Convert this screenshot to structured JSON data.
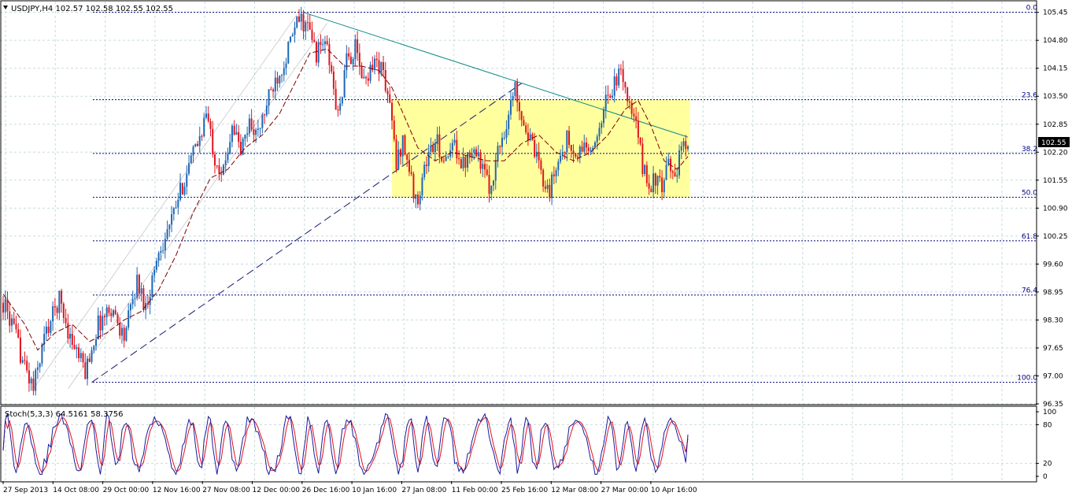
{
  "colors": {
    "background": "#ffffff",
    "grid": "#c8dcdc",
    "bull_candle": "#1e66b4",
    "bear_candle": "#e0141e",
    "moving_average": "#800000",
    "fib_lines": "#000080",
    "rectangle_fill": "#ffff9e",
    "resistance_line": "#0e8a8a",
    "support_line": "#1a1a6e",
    "stoch_main": "#1a1a9e",
    "stoch_signal": "#e01020",
    "price_label_bg": "#000000",
    "price_label_text": "#ffffff"
  },
  "header": {
    "title": "USDJPY,H4  102.57 102.58 102.55 102.55",
    "symbol": "USDJPY",
    "timeframe": "H4",
    "open": 102.57,
    "high": 102.58,
    "low": 102.55,
    "close": 102.55
  },
  "stochastic": {
    "label": "Stoch(5,3,3) 64.5161 58.3756",
    "main": 64.5161,
    "signal": 58.3756,
    "levels": [
      "100",
      "80",
      "20",
      "0"
    ]
  },
  "current_price": "102.55",
  "chart_data": {
    "type": "candlestick",
    "title": "USDJPY,H4",
    "ylim": [
      96.35,
      105.7
    ],
    "y_ticks": [
      "105.45",
      "104.80",
      "104.15",
      "103.50",
      "102.85",
      "102.20",
      "101.55",
      "100.90",
      "100.25",
      "99.60",
      "98.95",
      "98.30",
      "97.65",
      "97.00",
      "96.35"
    ],
    "x_ticks": [
      "27 Sep 2013",
      "14 Oct 08:00",
      "29 Oct 00:00",
      "12 Nov 16:00",
      "27 Nov 08:00",
      "12 Dec 00:00",
      "26 Dec 16:00",
      "10 Jan 16:00",
      "27 Jan 08:00",
      "11 Feb 00:00",
      "25 Feb 16:00",
      "12 Mar 08:00",
      "27 Mar 00:00",
      "10 Apr 16:00"
    ],
    "price_path": [
      [
        0,
        98.7
      ],
      [
        4,
        98.2
      ],
      [
        10,
        97.2
      ],
      [
        14,
        96.7
      ],
      [
        19,
        97.9
      ],
      [
        26,
        98.8
      ],
      [
        31,
        97.9
      ],
      [
        38,
        97.1
      ],
      [
        44,
        98.2
      ],
      [
        50,
        98.6
      ],
      [
        56,
        97.9
      ],
      [
        62,
        99.2
      ],
      [
        66,
        98.6
      ],
      [
        72,
        99.9
      ],
      [
        78,
        100.6
      ],
      [
        84,
        101.6
      ],
      [
        90,
        102.4
      ],
      [
        94,
        103.1
      ],
      [
        98,
        102.1
      ],
      [
        102,
        101.7
      ],
      [
        106,
        102.9
      ],
      [
        110,
        102.2
      ],
      [
        114,
        102.9
      ],
      [
        118,
        102.6
      ],
      [
        122,
        103.3
      ],
      [
        126,
        103.9
      ],
      [
        130,
        104.3
      ],
      [
        134,
        104.9
      ],
      [
        137,
        105.3
      ],
      [
        141,
        105.1
      ],
      [
        145,
        104.5
      ],
      [
        149,
        104.8
      ],
      [
        152,
        104.0
      ],
      [
        155,
        103.0
      ],
      [
        159,
        104.3
      ],
      [
        163,
        104.6
      ],
      [
        167,
        103.8
      ],
      [
        171,
        104.3
      ],
      [
        175,
        104.2
      ],
      [
        179,
        103.3
      ],
      [
        182,
        101.9
      ],
      [
        185,
        102.5
      ],
      [
        188,
        101.8
      ],
      [
        191,
        101.0
      ],
      [
        194,
        101.6
      ],
      [
        197,
        102.2
      ],
      [
        201,
        102.4
      ],
      [
        205,
        101.9
      ],
      [
        209,
        102.4
      ],
      [
        213,
        101.9
      ],
      [
        217,
        102.4
      ],
      [
        221,
        102.0
      ],
      [
        225,
        101.3
      ],
      [
        229,
        102.2
      ],
      [
        233,
        102.9
      ],
      [
        237,
        103.7
      ],
      [
        241,
        102.9
      ],
      [
        245,
        102.3
      ],
      [
        249,
        101.7
      ],
      [
        253,
        101.3
      ],
      [
        257,
        102.0
      ],
      [
        261,
        102.5
      ],
      [
        265,
        102.0
      ],
      [
        269,
        102.4
      ],
      [
        273,
        102.1
      ],
      [
        277,
        103.1
      ],
      [
        281,
        103.6
      ],
      [
        284,
        103.9
      ],
      [
        287,
        104.0
      ],
      [
        290,
        103.2
      ],
      [
        293,
        102.8
      ],
      [
        296,
        101.9
      ],
      [
        299,
        101.4
      ],
      [
        302,
        101.6
      ],
      [
        305,
        101.3
      ],
      [
        308,
        101.9
      ],
      [
        311,
        101.7
      ],
      [
        314,
        102.2
      ],
      [
        317,
        102.55
      ]
    ],
    "moving_average_path": [
      [
        0,
        98.9
      ],
      [
        10,
        98.2
      ],
      [
        16,
        97.6
      ],
      [
        24,
        98.0
      ],
      [
        32,
        98.2
      ],
      [
        40,
        97.8
      ],
      [
        48,
        98.0
      ],
      [
        56,
        98.3
      ],
      [
        64,
        98.5
      ],
      [
        72,
        99.0
      ],
      [
        80,
        99.8
      ],
      [
        88,
        100.8
      ],
      [
        96,
        101.6
      ],
      [
        104,
        101.8
      ],
      [
        112,
        102.3
      ],
      [
        120,
        102.6
      ],
      [
        128,
        103.1
      ],
      [
        136,
        103.9
      ],
      [
        142,
        104.5
      ],
      [
        150,
        104.6
      ],
      [
        158,
        104.2
      ],
      [
        166,
        104.2
      ],
      [
        174,
        104.1
      ],
      [
        180,
        103.7
      ],
      [
        186,
        103.0
      ],
      [
        192,
        102.3
      ],
      [
        200,
        102.0
      ],
      [
        208,
        102.2
      ],
      [
        216,
        102.1
      ],
      [
        224,
        102.0
      ],
      [
        232,
        102.0
      ],
      [
        240,
        102.4
      ],
      [
        248,
        102.6
      ],
      [
        256,
        102.2
      ],
      [
        264,
        102.0
      ],
      [
        272,
        102.2
      ],
      [
        280,
        102.6
      ],
      [
        288,
        103.2
      ],
      [
        294,
        103.4
      ],
      [
        300,
        102.8
      ],
      [
        306,
        102.0
      ],
      [
        312,
        101.8
      ],
      [
        317,
        102.1
      ]
    ],
    "fibonacci": {
      "levels": [
        {
          "label": "0.0",
          "price": 105.45
        },
        {
          "label": "23.6",
          "price": 103.42
        },
        {
          "label": "38.2",
          "price": 102.17
        },
        {
          "label": "50.0",
          "price": 101.15
        },
        {
          "label": "61.8",
          "price": 100.14
        },
        {
          "label": "76.4",
          "price": 98.88
        },
        {
          "label": "100.0",
          "price": 96.85
        }
      ]
    },
    "rectangle": {
      "price_top": 103.42,
      "price_bottom": 101.15
    },
    "resistance_line": {
      "from_price": 105.45,
      "to_price": 102.55
    },
    "support_line": {
      "from_price": 96.85,
      "to_price": 103.8
    },
    "stochastic_levels": [
      100,
      80,
      20,
      0
    ]
  }
}
